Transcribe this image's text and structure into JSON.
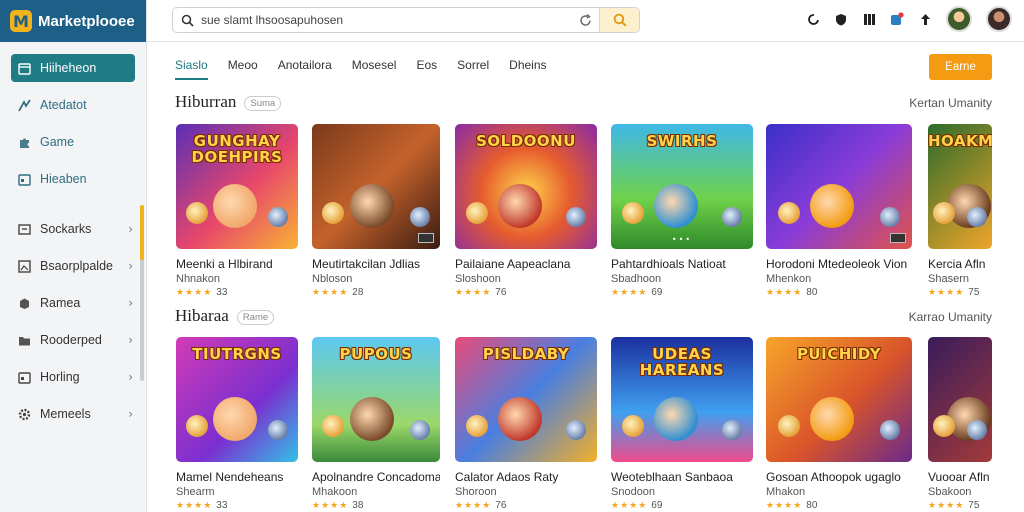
{
  "brand": {
    "name": "Marketplooee",
    "logo_letter": "M"
  },
  "search": {
    "value": "sue slamt lhsoosapuhosen"
  },
  "sidebar": {
    "primary": [
      {
        "label": "Hiiheheon",
        "icon": "calendar-icon",
        "active": true
      },
      {
        "label": "Atedatot",
        "icon": "chart-icon",
        "active": false
      },
      {
        "label": "Game",
        "icon": "puzzle-icon",
        "active": false
      },
      {
        "label": "Hieaben",
        "icon": "calendar-icon",
        "active": false
      }
    ],
    "secondary": [
      {
        "label": "Sockarks",
        "icon": "grid-icon"
      },
      {
        "label": "Bsaorplpalde",
        "icon": "image-icon"
      },
      {
        "label": "Ramea",
        "icon": "box-icon"
      },
      {
        "label": "Rooderped",
        "icon": "folder-icon"
      },
      {
        "label": "Horling",
        "icon": "calendar-icon"
      },
      {
        "label": "Memeels",
        "icon": "gear-icon"
      }
    ]
  },
  "tabs": [
    "Siaslo",
    "Meoo",
    "Anotailora",
    "Mosesel",
    "Eos",
    "Sorrel",
    "Dheins"
  ],
  "cta_label": "Earne",
  "sections": [
    {
      "title": "Hiburran",
      "tag": "Suma",
      "link": "Kertan Umanity",
      "cards": [
        {
          "thumb_text": "GUNGHAY DOEHPIRS",
          "title": "Meenki a Hlbirand",
          "sub": "Nhnakon",
          "rating": "33"
        },
        {
          "thumb_text": "",
          "title": "Meutirtakcilan Jdlias",
          "sub": "Nbloson",
          "rating": "28"
        },
        {
          "thumb_text": "SOLDOONU",
          "title": "Pailaiane Aapeaclana",
          "sub": "Sloshoon",
          "rating": "76"
        },
        {
          "thumb_text": "SWIRHS",
          "title": "Pahtardhioals Natioat",
          "sub": "Sbadhoon",
          "rating": "69"
        },
        {
          "thumb_text": "",
          "title": "Horodoni Mtedeoleok Vion",
          "sub": "Mhenkon",
          "rating": "80"
        },
        {
          "thumb_text": "HOAKM",
          "title": "Kercia Afln",
          "sub": "Shasern",
          "rating": "75"
        }
      ]
    },
    {
      "title": "Hibaraa",
      "tag": "Rame",
      "link": "Karrao Umanity",
      "cards": [
        {
          "thumb_text": "TIUTRGNS",
          "title": "Mamel Nendeheans",
          "sub": "Shearm",
          "rating": "33"
        },
        {
          "thumb_text": "PUPOUS",
          "title": "Apolnandre Concadoma",
          "sub": "Mhakoon",
          "rating": "38"
        },
        {
          "thumb_text": "PISLDABY",
          "title": "Calator Adaos Raty",
          "sub": "Shoroon",
          "rating": "76"
        },
        {
          "thumb_text": "UDEAS HAREANS",
          "title": "Weoteblhaan Sanbaoa",
          "sub": "Snodoon",
          "rating": "69"
        },
        {
          "thumb_text": "PUICHIDY",
          "title": "Gosoan Athoopok ugaglo",
          "sub": "Mhakon",
          "rating": "80"
        },
        {
          "thumb_text": "",
          "title": "Vuooar Afln",
          "sub": "Sbakoon",
          "rating": "75"
        }
      ]
    }
  ],
  "stars": "★★★★",
  "colors": {
    "brand": "#1d5f86",
    "accent": "#1f7b84",
    "cta": "#f59b12"
  }
}
